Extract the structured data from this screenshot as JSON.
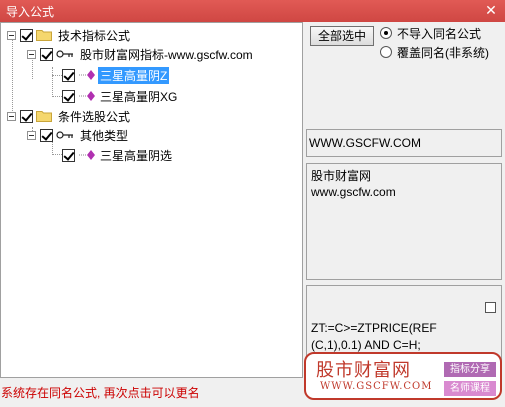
{
  "window": {
    "title": "导入公式",
    "close_glyph": "✕"
  },
  "tree": {
    "nodes": [
      {
        "id": "n1",
        "label": "技术指标公式",
        "type": "folder",
        "checked": true
      },
      {
        "id": "n2",
        "label": "股市财富网指标-www.gscfw.com",
        "type": "group",
        "checked": true
      },
      {
        "id": "n3",
        "label": "三星高量阴Z",
        "type": "leaf",
        "checked": true,
        "selected": true
      },
      {
        "id": "n4",
        "label": "三星高量阴XG",
        "type": "leaf",
        "checked": true
      },
      {
        "id": "n5",
        "label": "条件选股公式",
        "type": "folder",
        "checked": true
      },
      {
        "id": "n6",
        "label": "其他类型",
        "type": "group",
        "checked": true
      },
      {
        "id": "n7",
        "label": "三星高量阴选",
        "type": "leaf",
        "checked": true
      }
    ]
  },
  "controls": {
    "select_all_label": "全部选中",
    "radio_skip_label": "不导入同名公式",
    "radio_overwrite_label": "覆盖同名(非系统)",
    "radio_selected": "skip"
  },
  "info": {
    "url_text": "WWW.GSCFW.COM",
    "desc_line1": "股市财富网",
    "desc_line2": "www.gscfw.com",
    "code_line1": "ZT:=C>=ZTPRICE(REF",
    "code_line2": "(C,1),0.1) AND C=H;"
  },
  "status": {
    "message": "系统存在同名公式, 再次点击可以更名"
  },
  "watermark": {
    "site_name": "股市财富网",
    "site_url": "WWW.GSCFW.COM",
    "tag1": "指标分享",
    "tag2": "名师课程"
  },
  "colors": {
    "titlebar": "#d9534f",
    "selection": "#3399ff",
    "status_text": "#cc0000",
    "watermark": "#c0392b",
    "leaf_icon": "#b030b0",
    "folder": "#f5d76e"
  }
}
